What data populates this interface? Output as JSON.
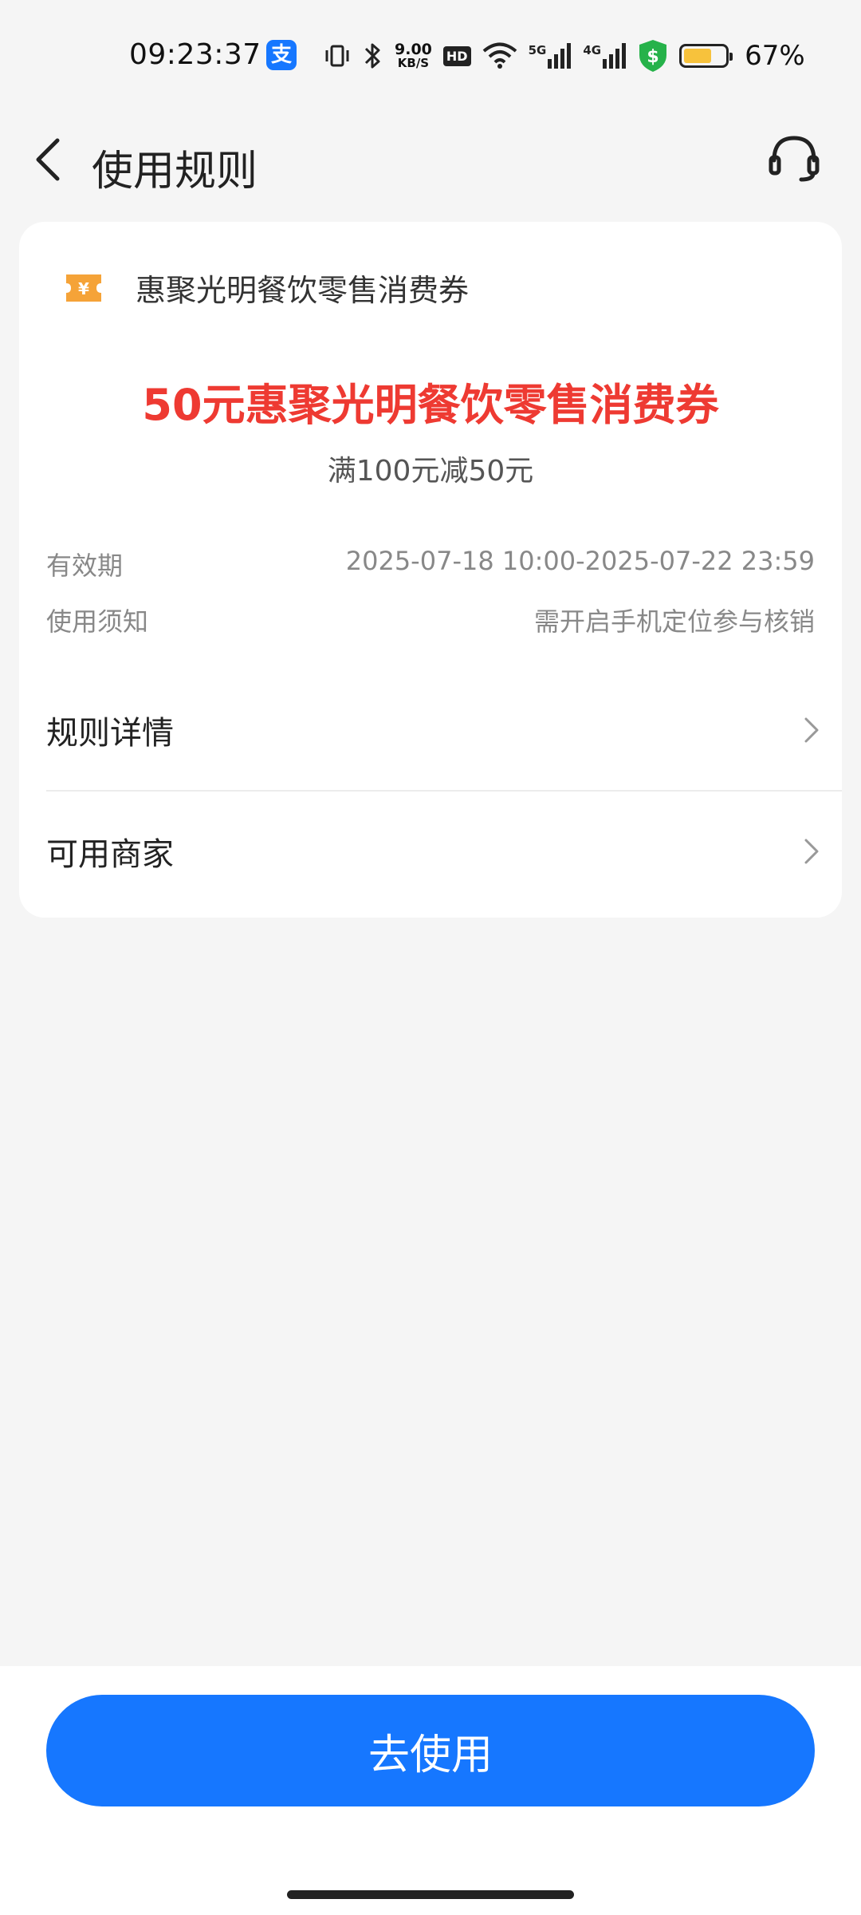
{
  "status_bar": {
    "time": "09:23:37",
    "alipay_badge": "支",
    "net_speed_value": "9.00",
    "net_speed_unit": "KB/S",
    "hd_badge": "HD",
    "signal_5g": "5G",
    "signal_4g": "4G",
    "battery_percent_text": "67%",
    "battery_level": 0.67,
    "icons": [
      "vibrate-icon",
      "bluetooth-icon",
      "wifi-icon",
      "signal-icon",
      "shield-icon",
      "battery-icon"
    ]
  },
  "header": {
    "title": "使用规则"
  },
  "coupon": {
    "brand": "惠聚光明餐饮零售消费券",
    "title": "50元惠聚光明餐饮零售消费券",
    "condition": "满100元减50元",
    "validity_label": "有效期",
    "validity_value": "2025-07-18 10:00-2025-07-22 23:59",
    "notice_label": "使用须知",
    "notice_value": "需开启手机定位参与核销",
    "title_color": "#ee3a32",
    "icon_color": "#f5a338"
  },
  "links": {
    "rules": "规则详情",
    "merchants": "可用商家"
  },
  "bottom": {
    "use_button": "去使用",
    "accent_color": "#1677ff"
  }
}
